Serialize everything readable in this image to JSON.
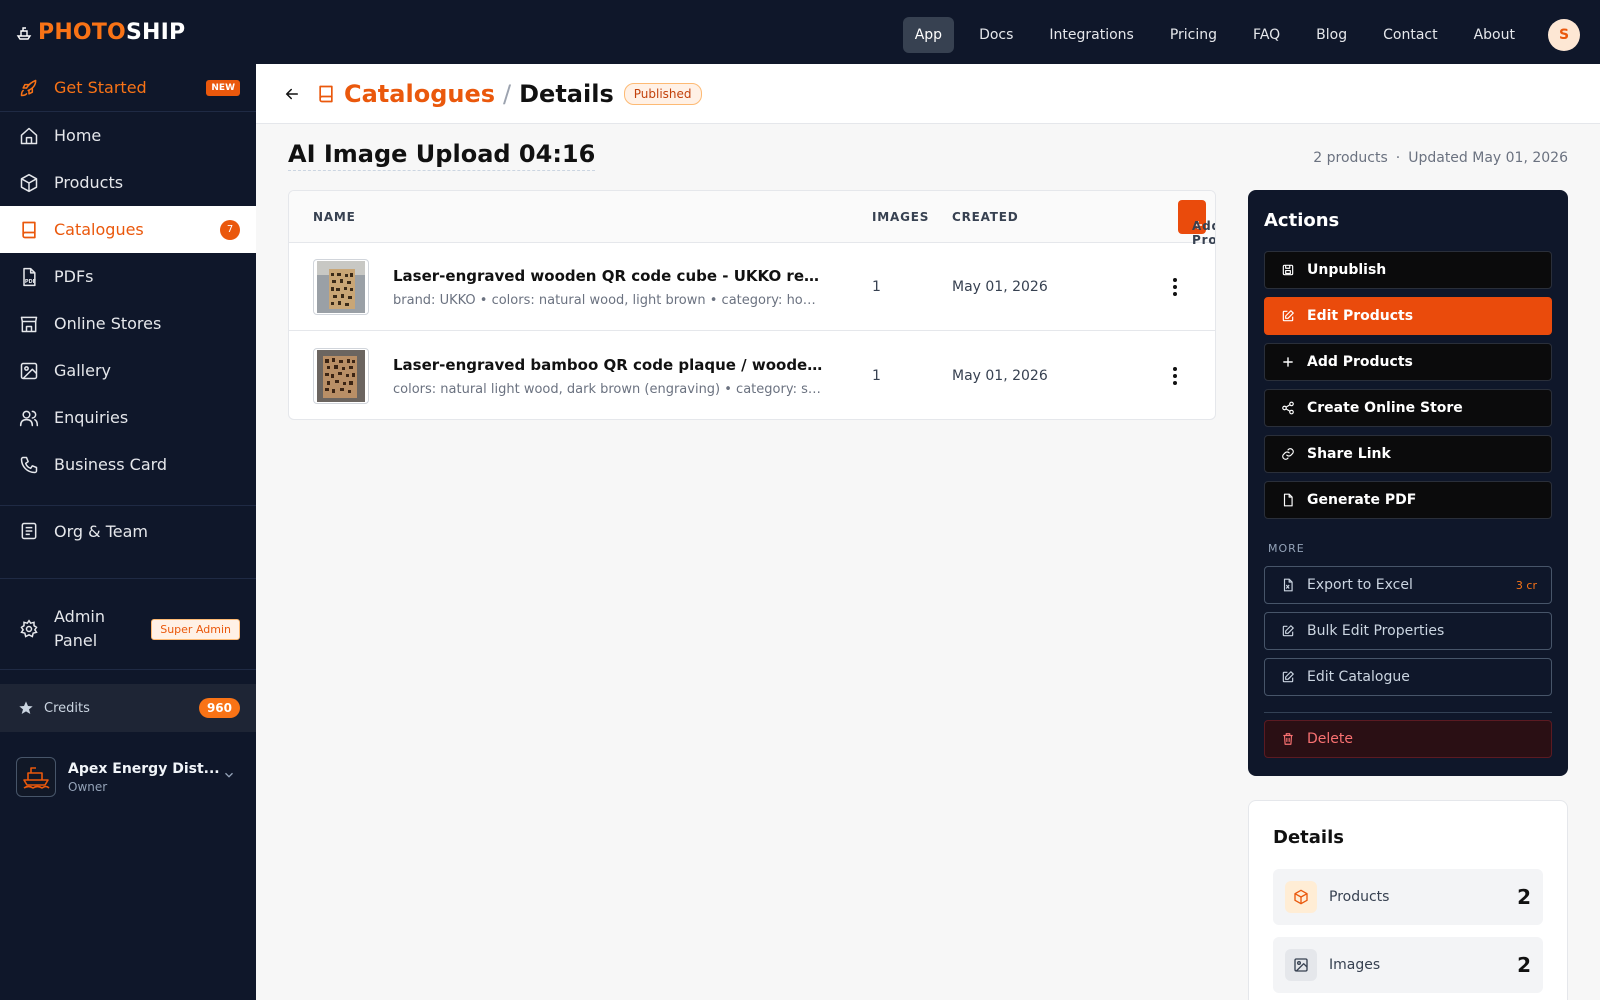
{
  "brand": {
    "part1": "PHOTO",
    "part2": "SHIP"
  },
  "nav": {
    "items": [
      "App",
      "Docs",
      "Integrations",
      "Pricing",
      "FAQ",
      "Blog",
      "Contact",
      "About"
    ],
    "avatar_initial": "S"
  },
  "sidebar": {
    "get_started": {
      "label": "Get Started",
      "badge": "NEW"
    },
    "items": [
      {
        "label": "Home",
        "icon": "home-icon"
      },
      {
        "label": "Products",
        "icon": "cube-icon"
      },
      {
        "label": "Catalogues",
        "icon": "book-icon",
        "badge": "7"
      },
      {
        "label": "PDFs",
        "icon": "pdf-icon"
      },
      {
        "label": "Online Stores",
        "icon": "store-icon"
      },
      {
        "label": "Gallery",
        "icon": "image-icon"
      },
      {
        "label": "Enquiries",
        "icon": "users-icon"
      },
      {
        "label": "Business Card",
        "icon": "phone-icon"
      }
    ],
    "org_team": "Org & Team",
    "admin": {
      "label_line1": "Admin",
      "label_line2": "Panel",
      "badge": "Super Admin"
    },
    "credits": {
      "label": "Credits",
      "value": "960"
    },
    "org": {
      "name": "Apex Energy Dist...",
      "role": "Owner"
    }
  },
  "header": {
    "breadcrumb_parent": "Catalogues",
    "breadcrumb_sep": "/",
    "breadcrumb_current": "Details",
    "status": "Published"
  },
  "catalogue": {
    "title": "AI Image Upload 04:16",
    "product_count": "2 products",
    "meta_sep": "·",
    "updated": "Updated May 01, 2026"
  },
  "table": {
    "columns": {
      "name": "NAME",
      "images": "IMAGES",
      "created": "CREATED"
    },
    "add_button": "Add Products",
    "rows": [
      {
        "name": "Laser-engraved wooden QR code cube - UKKO restaurant",
        "desc": "brand: UKKO • colors: natural wood, light brown • category: home decor",
        "images": "1",
        "created": "May 01, 2026"
      },
      {
        "name": "Laser-engraved bamboo QR code plaque / wooden sign",
        "desc": "colors: natural light wood, dark brown (engraving) • category: signage",
        "images": "1",
        "created": "May 01, 2026"
      }
    ]
  },
  "actions": {
    "title": "Actions",
    "unpublish": "Unpublish",
    "edit_products": "Edit Products",
    "add_products": "Add Products",
    "create_store": "Create Online Store",
    "share_link": "Share Link",
    "generate_pdf": "Generate PDF",
    "more_label": "MORE",
    "export_excel": "Export to Excel",
    "export_cost": "3 cr",
    "bulk_edit": "Bulk Edit Properties",
    "edit_catalogue": "Edit Catalogue",
    "delete": "Delete"
  },
  "details": {
    "title": "Details",
    "products_label": "Products",
    "products_value": "2",
    "images_label": "Images",
    "images_value": "2"
  },
  "colors": {
    "accent": "#ea580c",
    "navy": "#0f172a",
    "danger": "#f87171"
  }
}
